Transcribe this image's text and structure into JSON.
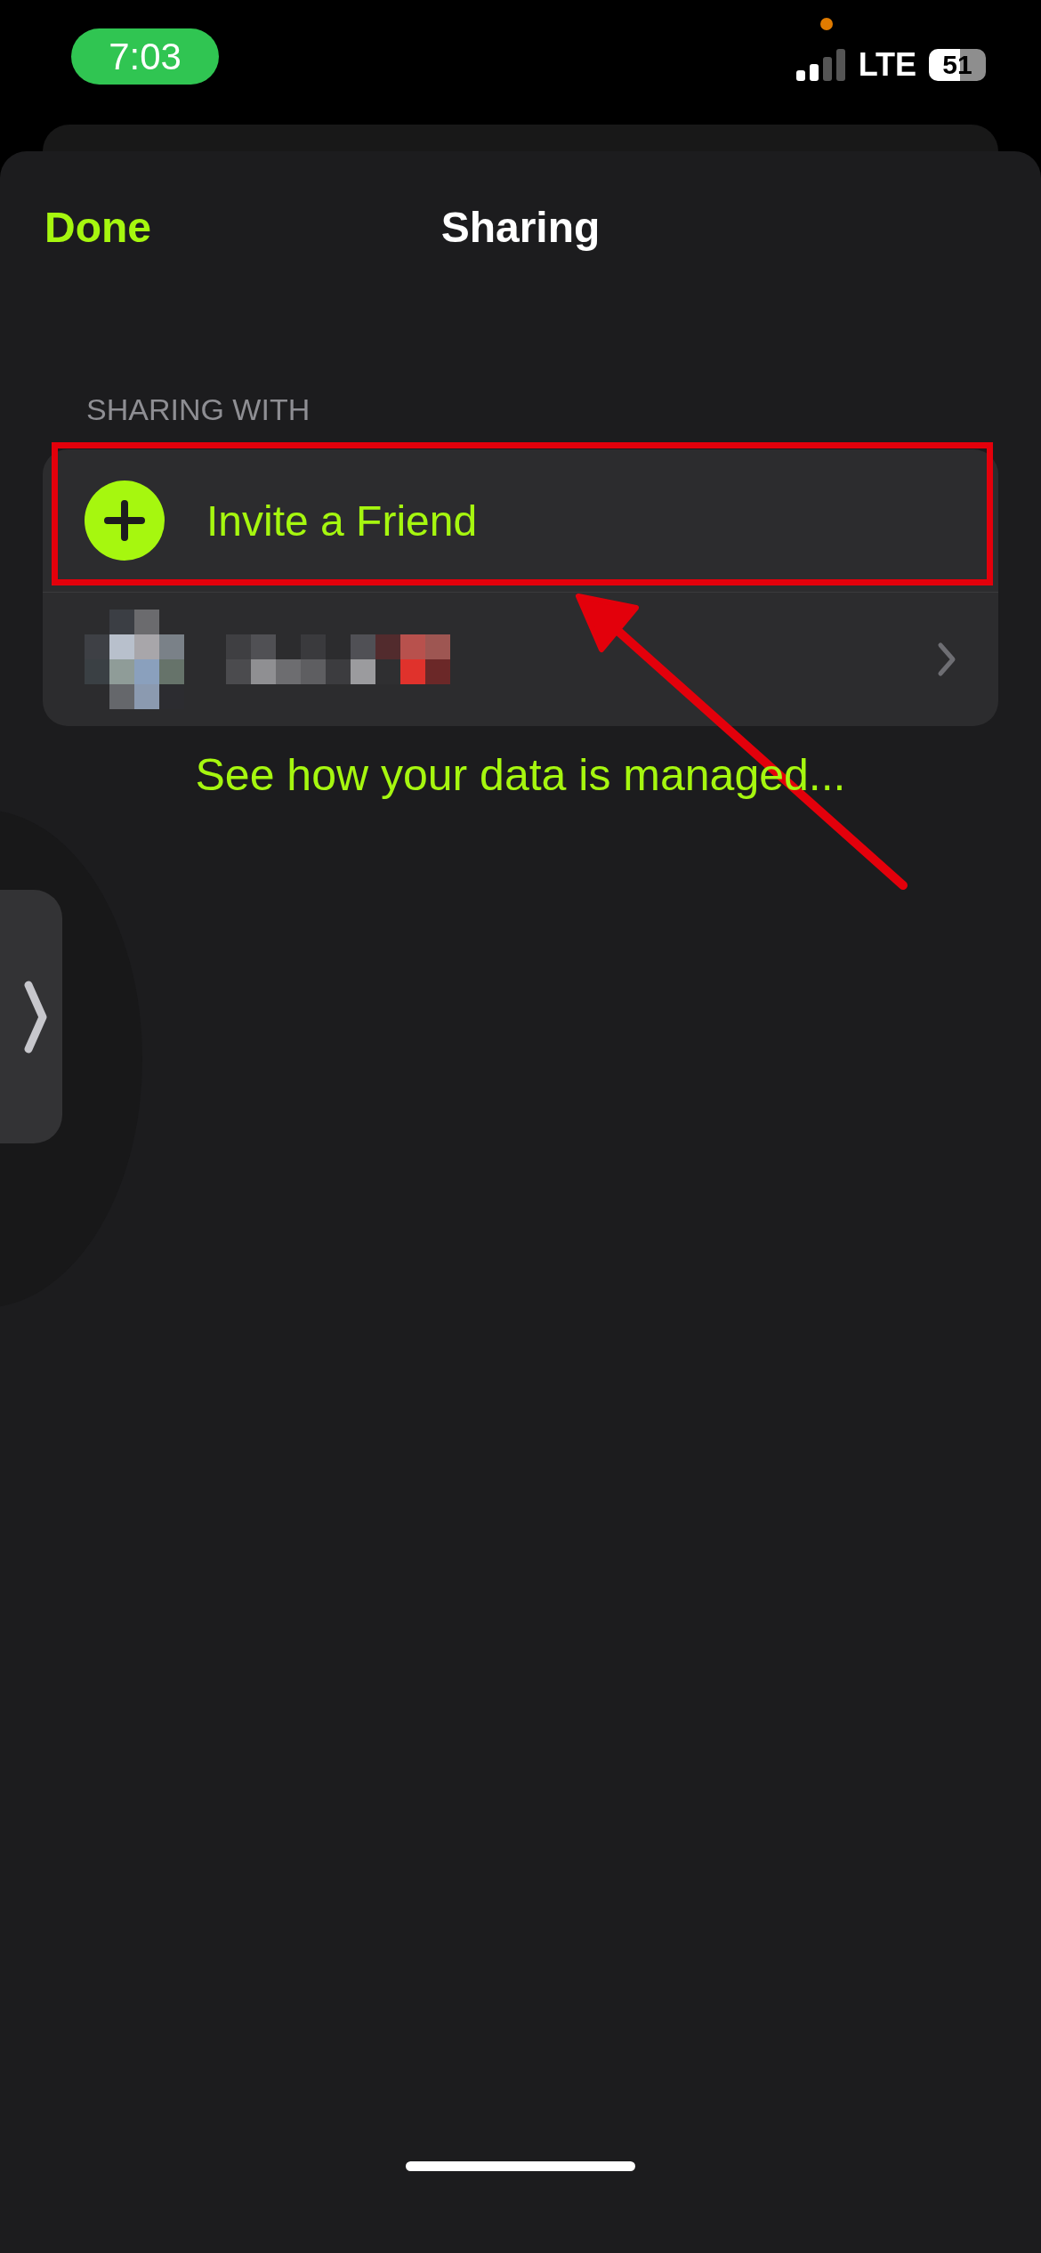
{
  "status_bar": {
    "time": "7:03",
    "network": "LTE",
    "battery": "51"
  },
  "nav": {
    "done": "Done",
    "title": "Sharing"
  },
  "section": {
    "header": "SHARING WITH",
    "rows": [
      {
        "kind": "invite",
        "label": "Invite a Friend"
      },
      {
        "kind": "person"
      }
    ]
  },
  "link": "See how your data is managed..."
}
